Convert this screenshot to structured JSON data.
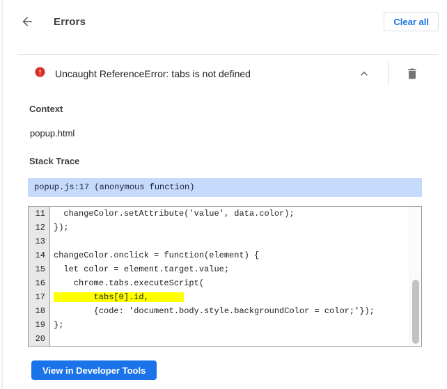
{
  "header": {
    "title": "Errors",
    "clear_all_label": "Clear all"
  },
  "error_entry": {
    "message": "Uncaught ReferenceError: tabs is not defined",
    "context_heading": "Context",
    "context_value": "popup.html",
    "stack_trace_heading": "Stack Trace",
    "stack_frame": "popup.js:17 (anonymous function)"
  },
  "code": {
    "lines": [
      {
        "num": "11",
        "text": "  changeColor.setAttribute('value', data.color);",
        "highlight": false
      },
      {
        "num": "12",
        "text": "});",
        "highlight": false
      },
      {
        "num": "13",
        "text": "",
        "highlight": false
      },
      {
        "num": "14",
        "text": "changeColor.onclick = function(element) {",
        "highlight": false
      },
      {
        "num": "15",
        "text": "  let color = element.target.value;",
        "highlight": false
      },
      {
        "num": "16",
        "text": "    chrome.tabs.executeScript(",
        "highlight": false
      },
      {
        "num": "17",
        "text": "        tabs[0].id,",
        "highlight": true
      },
      {
        "num": "18",
        "text": "        {code: 'document.body.style.backgroundColor = color;'});",
        "highlight": false
      },
      {
        "num": "19",
        "text": "};",
        "highlight": false
      },
      {
        "num": "20",
        "text": "",
        "highlight": false
      }
    ]
  },
  "footer": {
    "view_button_label": "View in Developer Tools"
  },
  "icons": {
    "back": "arrow-left",
    "error": "error-circle-filled",
    "collapse": "chevron-up",
    "delete": "trash",
    "clear": "none"
  },
  "colors": {
    "accent_blue": "#1a73e8",
    "error_red": "#d93025",
    "stack_bar_bg": "#c6dafc",
    "highlight_yellow": "#ffff00",
    "icon_gray": "#757575",
    "divider_gray": "#e0e0e0"
  }
}
